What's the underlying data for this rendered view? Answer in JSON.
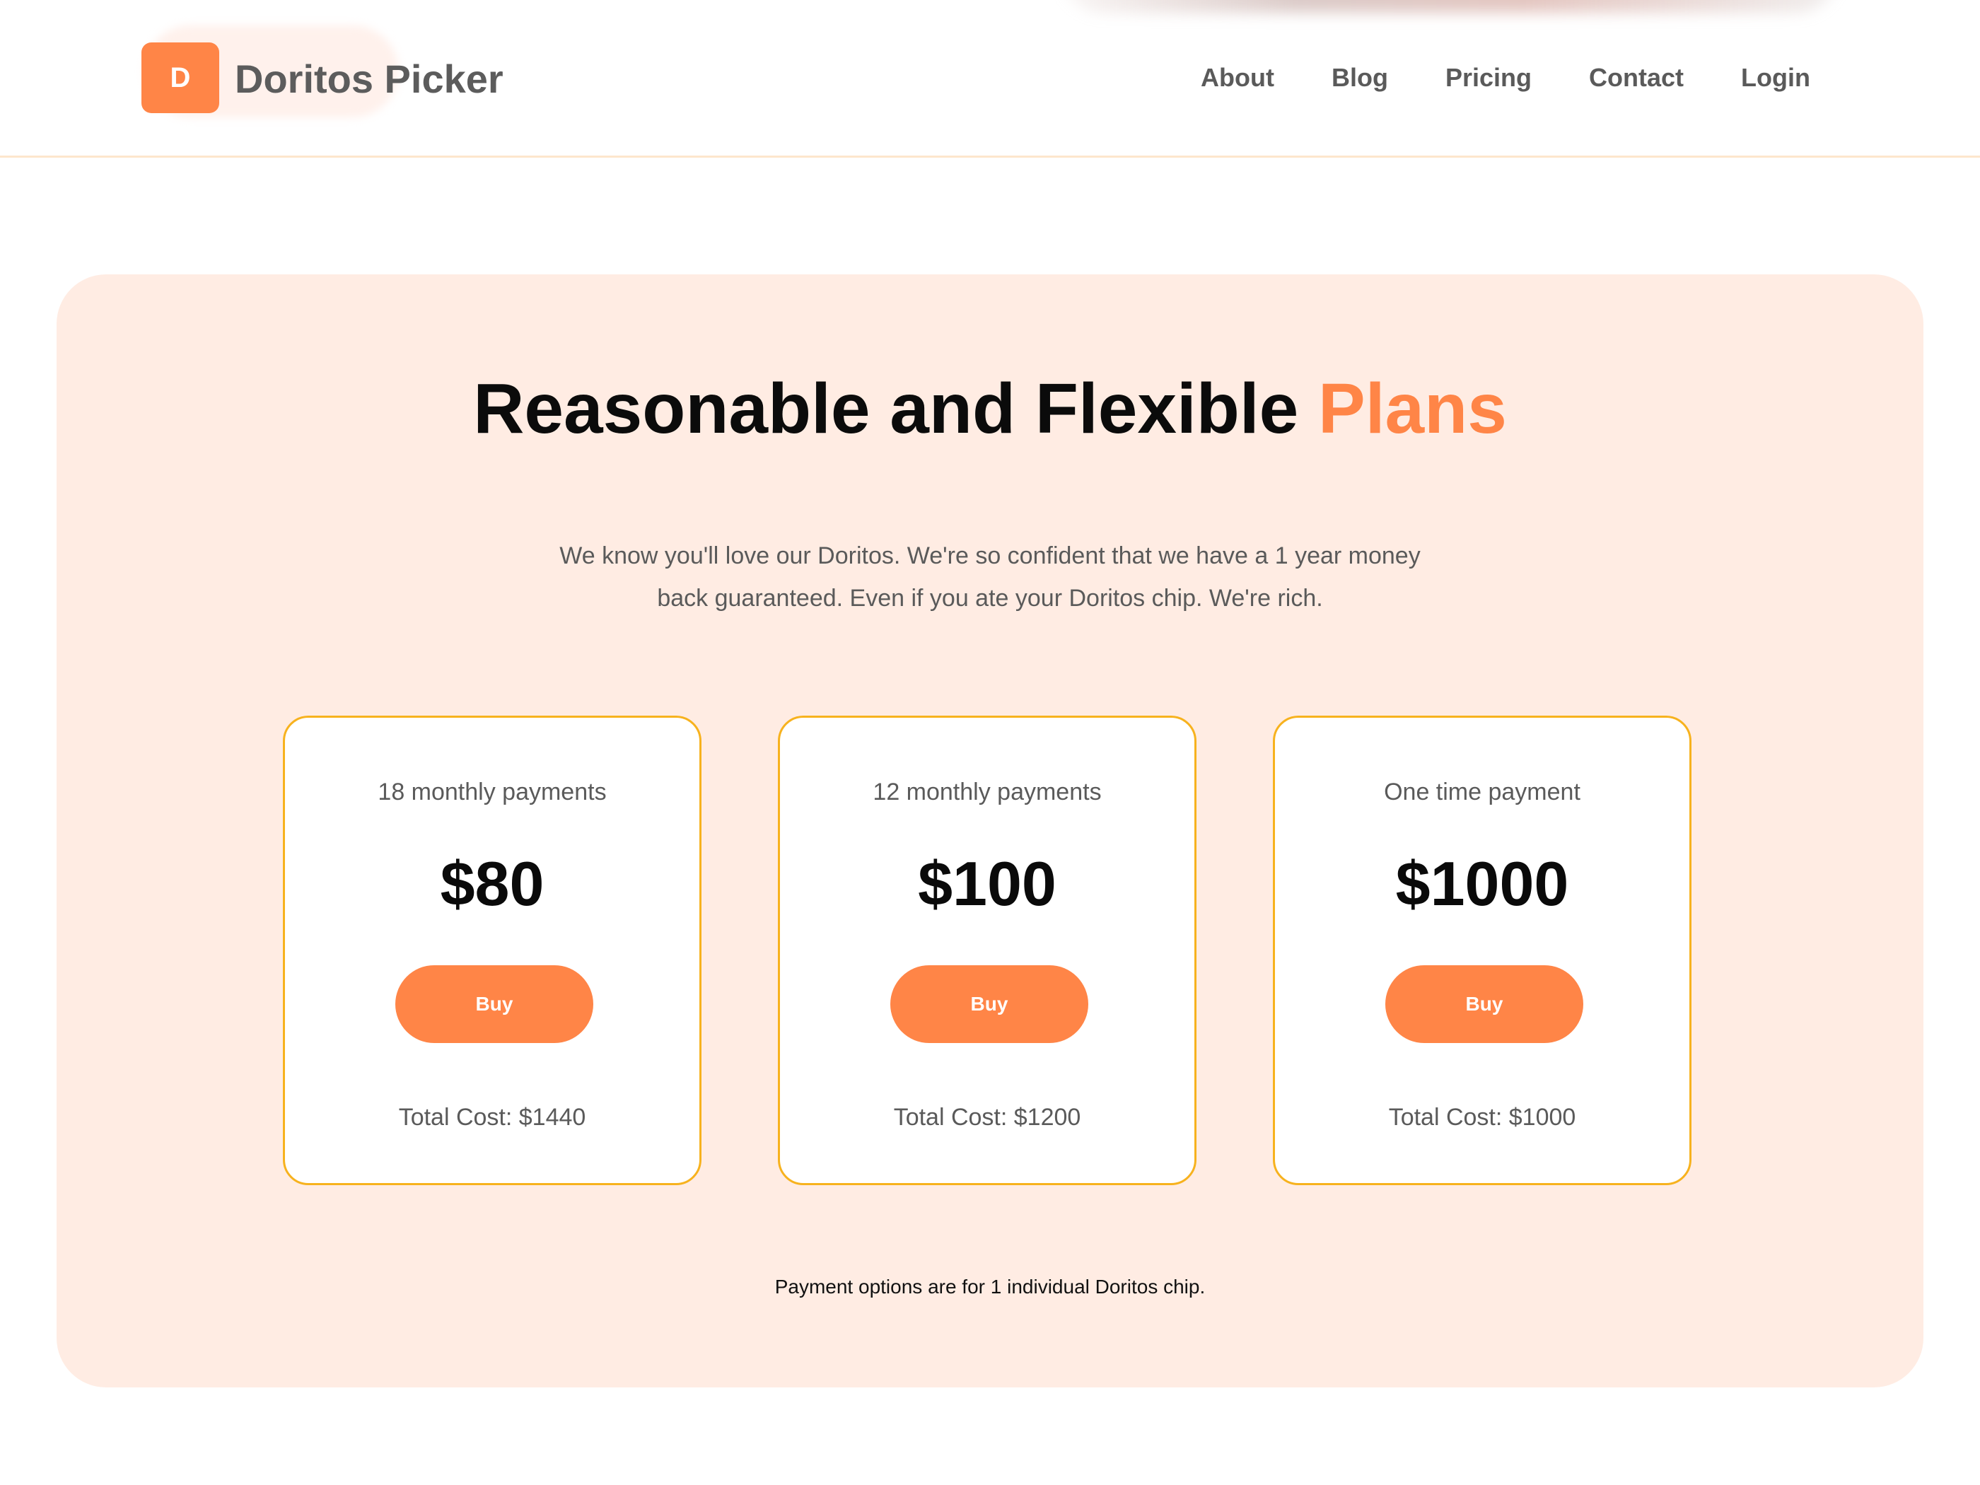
{
  "brand": {
    "badge_letter": "D",
    "name": "Doritos Picker"
  },
  "nav": {
    "items": [
      {
        "label": "About"
      },
      {
        "label": "Blog"
      },
      {
        "label": "Pricing"
      },
      {
        "label": "Contact"
      },
      {
        "label": "Login"
      }
    ]
  },
  "pricing": {
    "title_main": "Reasonable and Flexible ",
    "title_accent": "Plans",
    "intro": "We know you'll love our Doritos. We're so confident that we have a 1 year money back guaranteed. Even if you ate your Doritos chip. We're rich.",
    "plans": [
      {
        "label": "18 monthly payments",
        "price": "$80",
        "button": "Buy",
        "total": "Total Cost: $1440"
      },
      {
        "label": "12 monthly payments",
        "price": "$100",
        "button": "Buy",
        "total": "Total Cost: $1200"
      },
      {
        "label": "One time payment",
        "price": "$1000",
        "button": "Buy",
        "total": "Total Cost: $1000"
      }
    ],
    "footnote": "Payment options are for 1 individual Doritos chip."
  },
  "colors": {
    "accent": "#ff8547",
    "panel_bg": "#ffece3",
    "card_border": "#f7b21e",
    "header_border": "#fde6cd"
  }
}
